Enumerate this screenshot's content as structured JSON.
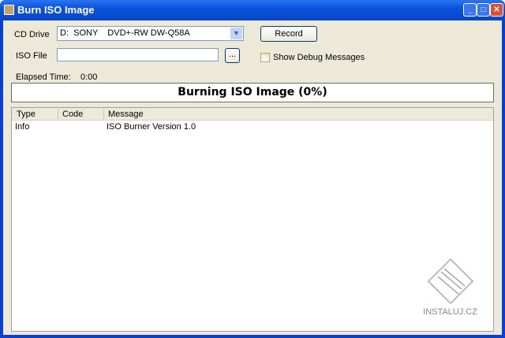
{
  "window": {
    "title": "Burn ISO Image"
  },
  "form": {
    "cd_drive_label": "CD Drive",
    "cd_drive_value": "D:  SONY    DVD+-RW DW-Q58A",
    "iso_file_label": "ISO File",
    "iso_file_value": "",
    "browse_label": "...",
    "record_label": "Record",
    "debug_label": "Show Debug Messages",
    "debug_checked": false,
    "elapsed_label": "Elapsed Time:",
    "elapsed_value": "0:00"
  },
  "progress": {
    "text": "Burning ISO Image (0%)",
    "percent": 0
  },
  "log": {
    "columns": [
      "Type",
      "Code",
      "Message"
    ],
    "rows": [
      {
        "type": "Info",
        "code": "",
        "message": "ISO Burner Version 1.0"
      }
    ]
  },
  "watermark": "INSTALUJ.CZ"
}
